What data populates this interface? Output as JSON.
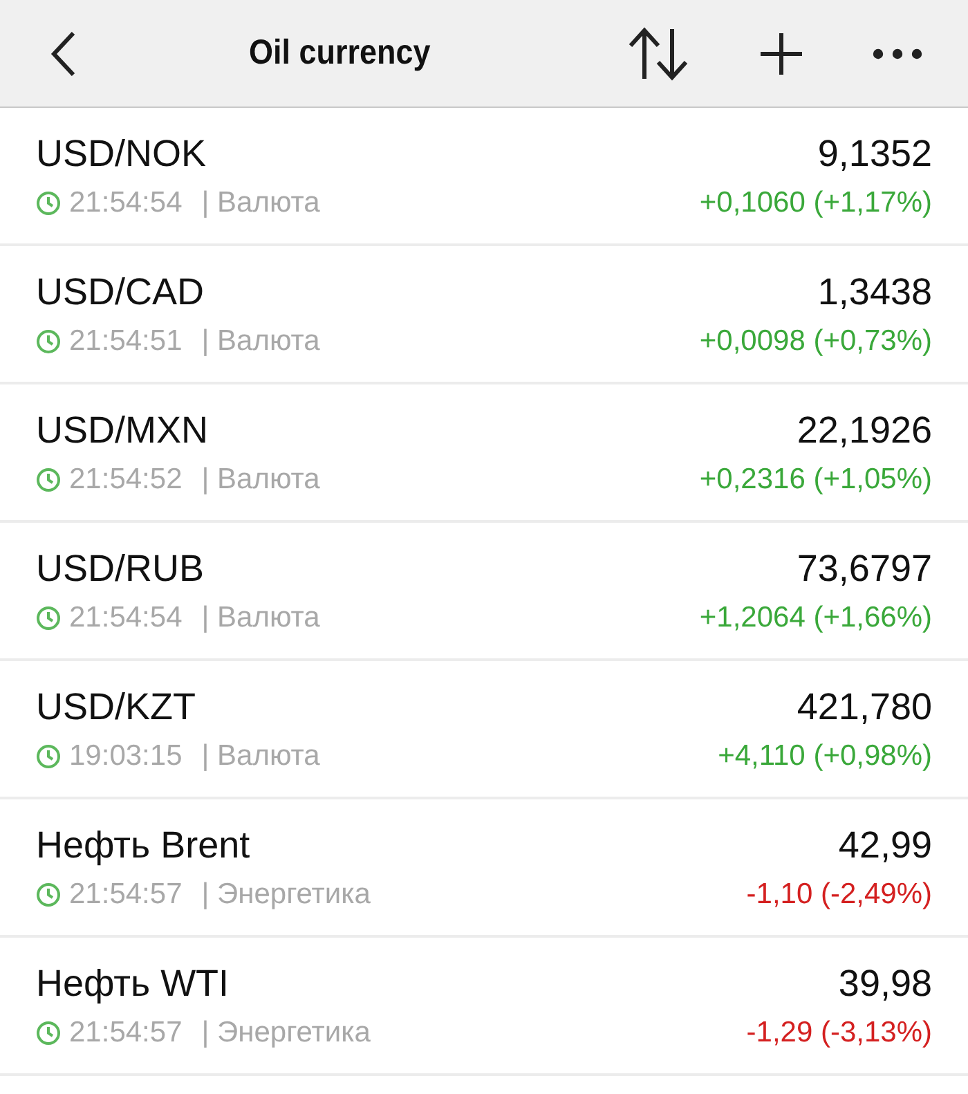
{
  "header": {
    "title": "Oil currency"
  },
  "quotes": [
    {
      "name": "USD/NOK",
      "price": "9,1352",
      "time": "21:54:54",
      "category": "| Валюта",
      "change": "+0,1060 (+1,17%)",
      "color": "#3aa83a"
    },
    {
      "name": "USD/CAD",
      "price": "1,3438",
      "time": "21:54:51",
      "category": "| Валюта",
      "change": "+0,0098 (+0,73%)",
      "color": "#3aa83a"
    },
    {
      "name": "USD/MXN",
      "price": "22,1926",
      "time": "21:54:52",
      "category": "| Валюта",
      "change": "+0,2316 (+1,05%)",
      "color": "#3aa83a"
    },
    {
      "name": "USD/RUB",
      "price": "73,6797",
      "time": "21:54:54",
      "category": "| Валюта",
      "change": "+1,2064 (+1,66%)",
      "color": "#3aa83a"
    },
    {
      "name": "USD/KZT",
      "price": "421,780",
      "time": "19:03:15",
      "category": "| Валюта",
      "change": "+4,110 (+0,98%)",
      "color": "#3aa83a"
    },
    {
      "name": "Нефть Brent",
      "price": "42,99",
      "time": "21:54:57",
      "category": "| Энергетика",
      "change": "-1,10 (-2,49%)",
      "color": "#d42020"
    },
    {
      "name": "Нефть WTI",
      "price": "39,98",
      "time": "21:54:57",
      "category": "| Энергетика",
      "change": "-1,29 (-3,13%)",
      "color": "#d42020"
    }
  ]
}
